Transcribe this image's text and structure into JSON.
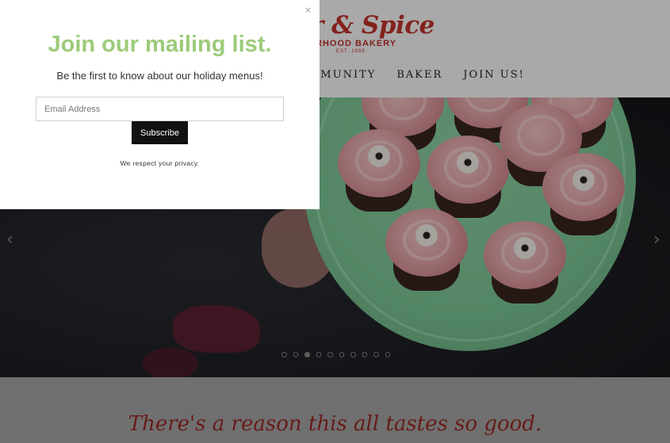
{
  "header": {
    "logo_main": "r & Spice",
    "logo_sub": "RHOOD BAKERY",
    "logo_est": "EST. 1998",
    "nav": [
      {
        "label": "MMUNITY"
      },
      {
        "label": "BAKER"
      },
      {
        "label": "JOIN US!"
      }
    ]
  },
  "slider": {
    "prev_icon": "chevron-left-icon",
    "next_icon": "chevron-right-icon",
    "dot_count": 10,
    "active_dot": 2
  },
  "bottom": {
    "tagline": "There's a reason this all tastes so good."
  },
  "popup": {
    "close_label": "×",
    "title": "Join our mailing list.",
    "subtitle": "Be the first to know about our holiday menus!",
    "email_placeholder": "Email Address",
    "email_value": "",
    "subscribe_label": "Subscribe",
    "privacy_text": "We respect your privacy."
  },
  "colors": {
    "brand_red": "#c3332c",
    "popup_title_green": "#9ccb7a",
    "button_black": "#111111"
  }
}
